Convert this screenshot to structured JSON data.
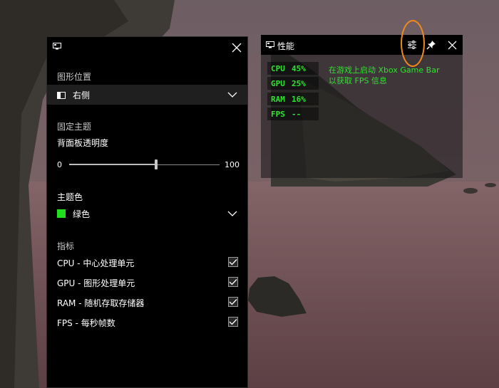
{
  "settings_panel": {
    "position_section_label": "图形位置",
    "position_value": "右侧",
    "pinned_theme_label": "固定主题",
    "opacity_label": "背面板透明度",
    "opacity_min": "0",
    "opacity_max": "100",
    "opacity_level_percent": 58,
    "accent_label": "主题色",
    "accent_value": "绿色",
    "accent_color": "#1ee01e",
    "metrics_label": "指标",
    "metrics": [
      {
        "label": "CPU - 中心处理单元",
        "checked": true
      },
      {
        "label": "GPU - 图形处理单元",
        "checked": true
      },
      {
        "label": "RAM - 随机存取存储器",
        "checked": true
      },
      {
        "label": "FPS - 每秒帧数",
        "checked": true
      }
    ],
    "icons": {
      "title": "monitor-icon",
      "close": "close-icon",
      "position": "panel-right-icon",
      "chevron": "chevron-down-icon",
      "check": "checkmark-icon"
    }
  },
  "performance_widget": {
    "title": "性能",
    "stats": [
      {
        "label": "CPU",
        "value": "45%"
      },
      {
        "label": "GPU",
        "value": "25%"
      },
      {
        "label": "RAM",
        "value": "16%"
      },
      {
        "label": "FPS",
        "value": "--"
      }
    ],
    "hint_line1": "在游戏上启动 Xbox Game Bar",
    "hint_line2": "以获取 FPS 信息",
    "text_color": "#2de32d",
    "highlight_color": "#f08a1c",
    "icons": {
      "title": "monitor-icon",
      "settings": "sliders-icon",
      "pin": "pin-icon",
      "close": "close-icon"
    }
  }
}
